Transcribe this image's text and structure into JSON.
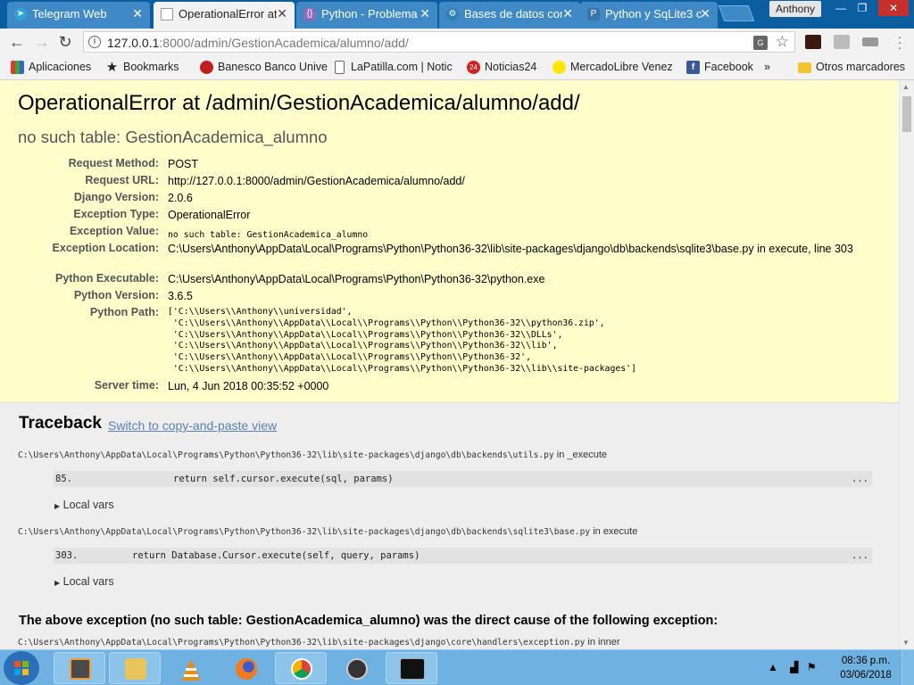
{
  "browser": {
    "tabs": [
      {
        "title": "Telegram Web",
        "icon": "telegram-icon",
        "active": false
      },
      {
        "title": "OperationalError at",
        "icon": "document-icon",
        "active": true
      },
      {
        "title": "Python - Problema",
        "icon": "brackets-icon",
        "active": false
      },
      {
        "title": "Bases de datos con",
        "icon": "settings-icon",
        "active": false
      },
      {
        "title": "Python y SqLite3 c",
        "icon": "python-icon",
        "active": false
      }
    ],
    "profile_name": "Anthony",
    "url_host": "127.0.0.1",
    "url_path": ":8000/admin/GestionAcademica/alumno/add/",
    "bookmarks": [
      {
        "label": "Aplicaciones",
        "icon": "apps-icon"
      },
      {
        "label": "Bookmarks",
        "icon": "star-icon"
      },
      {
        "label": "Banesco Banco Unive",
        "icon": "banesco-icon"
      },
      {
        "label": "LaPatilla.com | Notic",
        "icon": "page-icon"
      },
      {
        "label": "Noticias24",
        "icon": "noticias24-icon"
      },
      {
        "label": "MercadoLibre Venez",
        "icon": "mercadolibre-icon"
      },
      {
        "label": "Facebook",
        "icon": "facebook-icon"
      },
      {
        "label": "»",
        "icon": ""
      },
      {
        "label": "Otros marcadores",
        "icon": "folder-icon"
      }
    ]
  },
  "error": {
    "title": "OperationalError at /admin/GestionAcademica/alumno/add/",
    "subtitle": "no such table: GestionAcademica_alumno",
    "meta": [
      {
        "key": "Request Method:",
        "value": "POST"
      },
      {
        "key": "Request URL:",
        "value": "http://127.0.0.1:8000/admin/GestionAcademica/alumno/add/"
      },
      {
        "key": "Django Version:",
        "value": "2.0.6"
      },
      {
        "key": "Exception Type:",
        "value": "OperationalError"
      },
      {
        "key": "Exception Value:",
        "value": "no such table: GestionAcademica_alumno"
      },
      {
        "key": "Exception Location:",
        "value": "C:\\Users\\Anthony\\AppData\\Local\\Programs\\Python\\Python36-32\\lib\\site-packages\\django\\db\\backends\\sqlite3\\base.py in execute, line 303"
      },
      {
        "key": "Python Executable:",
        "value": "C:\\Users\\Anthony\\AppData\\Local\\Programs\\Python\\Python36-32\\python.exe"
      },
      {
        "key": "Python Version:",
        "value": "3.6.5"
      },
      {
        "key": "Python Path:",
        "value": ""
      },
      {
        "key": "Server time:",
        "value": "Lun, 4 Jun 2018 00:35:52 +0000"
      }
    ],
    "python_path": [
      "['C:\\\\Users\\\\Anthony\\\\universidad',",
      " 'C:\\\\Users\\\\Anthony\\\\AppData\\\\Local\\\\Programs\\\\Python\\\\Python36-32\\\\python36.zip',",
      " 'C:\\\\Users\\\\Anthony\\\\AppData\\\\Local\\\\Programs\\\\Python\\\\Python36-32\\\\DLLs',",
      " 'C:\\\\Users\\\\Anthony\\\\AppData\\\\Local\\\\Programs\\\\Python\\\\Python36-32\\\\lib',",
      " 'C:\\\\Users\\\\Anthony\\\\AppData\\\\Local\\\\Programs\\\\Python\\\\Python36-32',",
      " 'C:\\\\Users\\\\Anthony\\\\AppData\\\\Local\\\\Programs\\\\Python\\\\Python36-32\\\\lib\\\\site-packages']"
    ]
  },
  "traceback": {
    "heading": "Traceback",
    "switch_link": "Switch to copy-and-paste view",
    "frames": [
      {
        "path": "C:\\Users\\Anthony\\AppData\\Local\\Programs\\Python\\Python36-32\\lib\\site-packages\\django\\db\\backends\\utils.py",
        "func": " in _execute",
        "line_no": "85.",
        "code": "return self.cursor.execute(sql, params)",
        "more": "...",
        "local_vars": "Local vars"
      },
      {
        "path": "C:\\Users\\Anthony\\AppData\\Local\\Programs\\Python\\Python36-32\\lib\\site-packages\\django\\db\\backends\\sqlite3\\base.py",
        "func": " in execute",
        "line_no": "303.",
        "code": "return Database.Cursor.execute(self, query, params)",
        "more": "...",
        "local_vars": "Local vars"
      }
    ],
    "cause": "The above exception (no such table: GestionAcademica_alumno) was the direct cause of the following exception:",
    "next_frame": {
      "path": "C:\\Users\\Anthony\\AppData\\Local\\Programs\\Python\\Python36-32\\lib\\site-packages\\django\\core\\handlers\\exception.py",
      "func": " in inner"
    }
  },
  "taskbar": {
    "apps": [
      "sublime-text-icon",
      "file-explorer-icon",
      "vlc-icon",
      "firefox-icon",
      "chrome-icon",
      "media-player-icon",
      "cmd-icon"
    ],
    "time": "08:36 p.m.",
    "date": "03/06/2018"
  },
  "colors": {
    "summary_bg": "#ffffcc",
    "traceback_bg": "#eeeeee",
    "link": "#5b80b2",
    "chrome_frame": "#0b5fa0",
    "taskbar": "#6fb1e0"
  }
}
